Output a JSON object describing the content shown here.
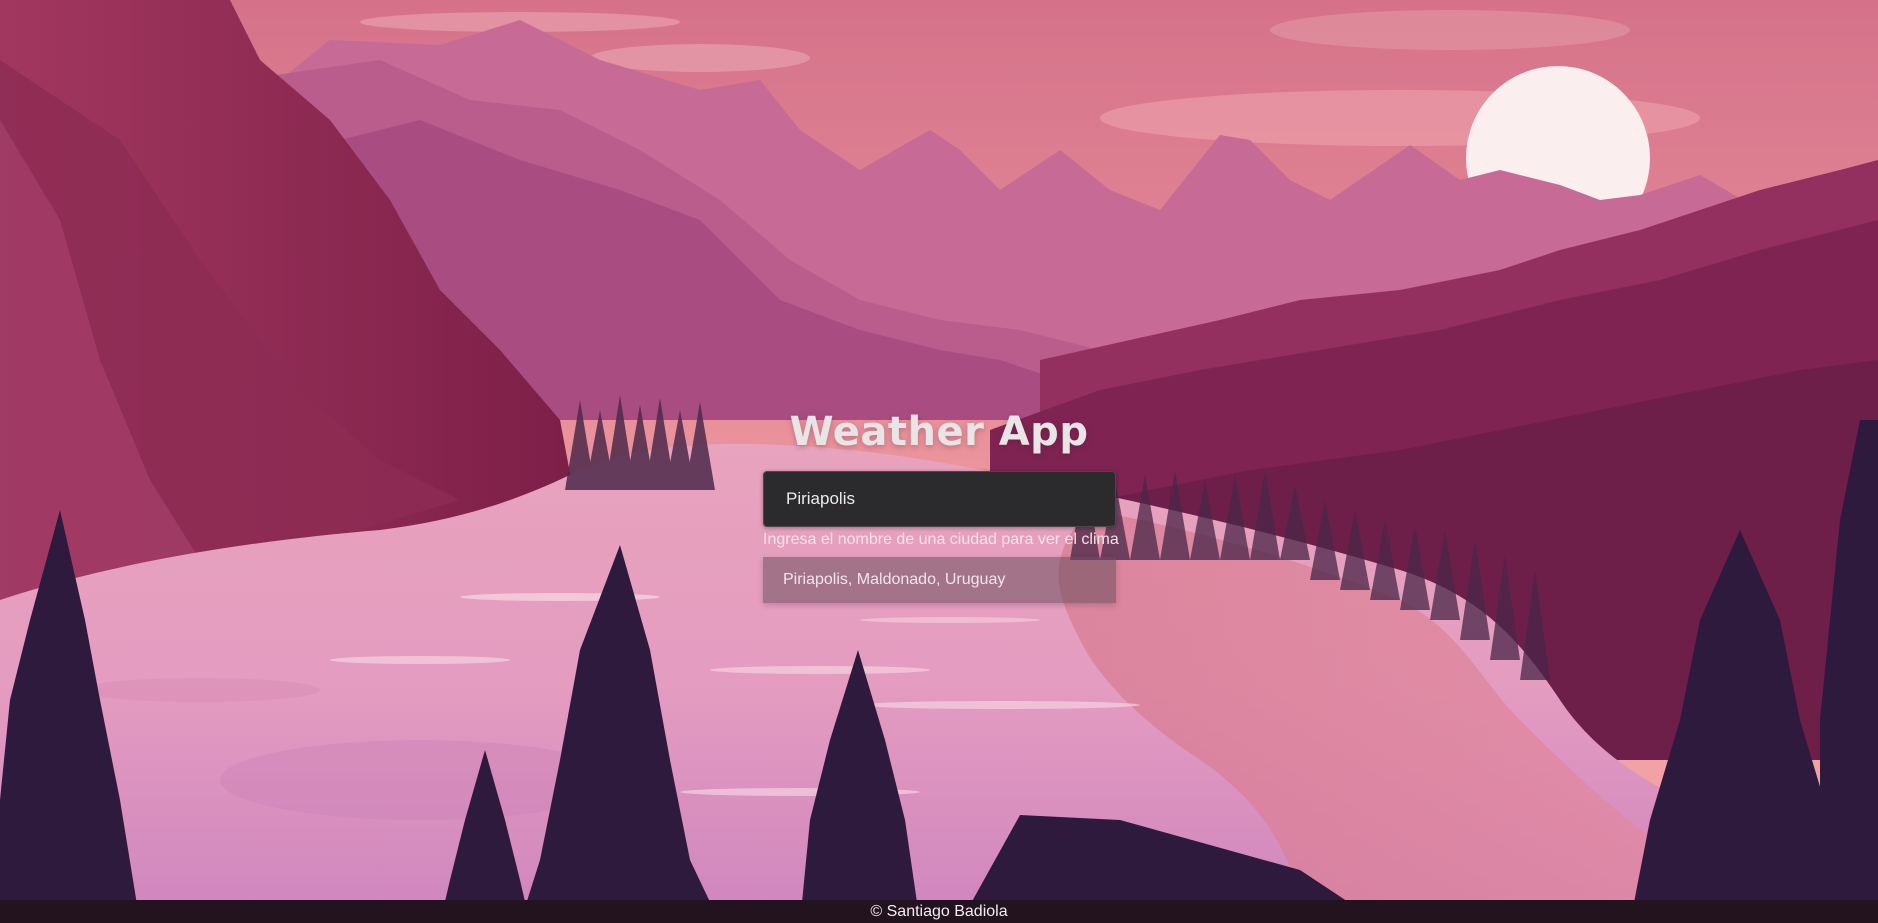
{
  "app": {
    "title": "Weather App"
  },
  "search": {
    "value": "Piriapolis",
    "helper_text": "Ingresa el nombre de una ciudad para ver el clima"
  },
  "suggestions": [
    {
      "label": "Piriapolis, Maldonado, Uruguay"
    }
  ],
  "footer": {
    "text": "© Santiago Badiola"
  },
  "theme": {
    "sky_top": "#d8748a",
    "sky_bottom": "#f0a0a4",
    "sun": "#fbeeee",
    "dark_tree": "#2e1a3d",
    "input_bg": "#2b2b2d",
    "footer_bg": "#22131f"
  }
}
